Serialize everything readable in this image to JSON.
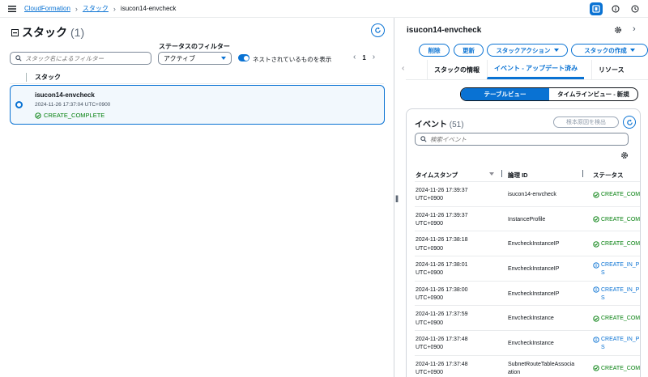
{
  "topbar": {
    "breadcrumbs": [
      "CloudFormation",
      "スタック",
      "isucon14-envcheck"
    ]
  },
  "left": {
    "title": "スタック",
    "count": "(1)",
    "filter_label": "ステータスのフィルター",
    "search_placeholder": "スタック名によるフィルター",
    "status_filter_value": "アクティブ",
    "nested_toggle_label": "ネストされているものを表示",
    "page_number": "1",
    "column_header": "スタック",
    "stack": {
      "name": "isucon14-envcheck",
      "timestamp": "2024-11-26 17:37:04 UTC+0900",
      "status": "CREATE_COMPLETE"
    }
  },
  "right": {
    "title": "isucon14-envcheck",
    "buttons": {
      "delete": "削除",
      "update": "更新",
      "stack_actions": "スタックアクション",
      "create_stack": "スタックの作成"
    },
    "tabs": [
      "スタックの情報",
      "イベント - アップデート済み",
      "リソース"
    ],
    "segments": [
      "テーブルビュー",
      "タイムラインビュー - 新規"
    ],
    "events": {
      "title": "イベント",
      "count": "(51)",
      "root_cause_button": "根本原因を検出",
      "search_placeholder": "検索イベント",
      "columns": [
        "タイムスタンプ",
        "論理 ID",
        "ステータス"
      ],
      "rows": [
        {
          "time1": "2024-11-26 17:39:37",
          "time2": "UTC+0900",
          "id1": "isucon14-envcheck",
          "id2": "",
          "status1": "CREATE_COM",
          "status2": "",
          "kind": "ok"
        },
        {
          "time1": "2024-11-26 17:39:37",
          "time2": "UTC+0900",
          "id1": "InstanceProfile",
          "id2": "",
          "status1": "CREATE_COM",
          "status2": "",
          "kind": "ok"
        },
        {
          "time1": "2024-11-26 17:38:18",
          "time2": "UTC+0900",
          "id1": "EnvcheckInstanceIP",
          "id2": "",
          "status1": "CREATE_COM",
          "status2": "",
          "kind": "ok"
        },
        {
          "time1": "2024-11-26 17:38:01",
          "time2": "UTC+0900",
          "id1": "EnvcheckInstanceIP",
          "id2": "",
          "status1": "CREATE_IN_PI",
          "status2": "S",
          "kind": "info"
        },
        {
          "time1": "2024-11-26 17:38:00",
          "time2": "UTC+0900",
          "id1": "EnvcheckInstanceIP",
          "id2": "",
          "status1": "CREATE_IN_PI",
          "status2": "S",
          "kind": "info"
        },
        {
          "time1": "2024-11-26 17:37:59",
          "time2": "UTC+0900",
          "id1": "EnvcheckInstance",
          "id2": "",
          "status1": "CREATE_COM",
          "status2": "",
          "kind": "ok"
        },
        {
          "time1": "2024-11-26 17:37:48",
          "time2": "UTC+0900",
          "id1": "EnvcheckInstance",
          "id2": "",
          "status1": "CREATE_IN_PI",
          "status2": "S",
          "kind": "info"
        },
        {
          "time1": "2024-11-26 17:37:48",
          "time2": "UTC+0900",
          "id1": "SubnetRouteTableAssocia",
          "id2": "ation",
          "status1": "CREATE_COM",
          "status2": "",
          "kind": "ok"
        }
      ]
    }
  },
  "colors": {
    "accent": "#0972d3",
    "success": "#037f0c",
    "text": "#0f141a"
  }
}
